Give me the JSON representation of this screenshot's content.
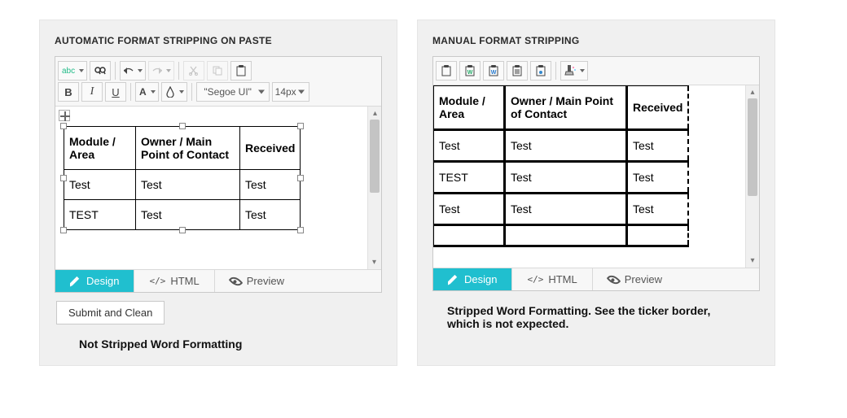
{
  "left": {
    "title": "AUTOMATIC FORMAT STRIPPING ON PASTE",
    "toolbar": {
      "spell": "abc",
      "font_name": "\"Segoe UI\"",
      "font_size": "14px",
      "bold": "B",
      "italic": "I",
      "underline": "U",
      "forecolor": "A"
    },
    "table": {
      "headers": [
        "Module / Area",
        "Owner / Main Point of Contact",
        "Received"
      ],
      "rows": [
        [
          "Test",
          "Test",
          "Test"
        ],
        [
          "TEST",
          "Test",
          "Test"
        ]
      ]
    },
    "views": {
      "design": "Design",
      "html": "HTML",
      "preview": "Preview",
      "html_icon": "</>"
    },
    "submit": "Submit and Clean",
    "caption": "Not Stripped Word Formatting"
  },
  "right": {
    "title": "MANUAL FORMAT STRIPPING",
    "table": {
      "headers": [
        "Module / Area",
        "Owner / Main Point of Contact",
        "Received"
      ],
      "rows": [
        [
          "Test",
          "Test",
          "Test"
        ],
        [
          "TEST",
          "Test",
          "Test"
        ],
        [
          "Test",
          "Test",
          "Test"
        ],
        [
          "",
          "",
          ""
        ]
      ]
    },
    "views": {
      "design": "Design",
      "html": "HTML",
      "preview": "Preview",
      "html_icon": "</>"
    },
    "caption": "Stripped Word Formatting. See the ticker border, which is not expected."
  }
}
